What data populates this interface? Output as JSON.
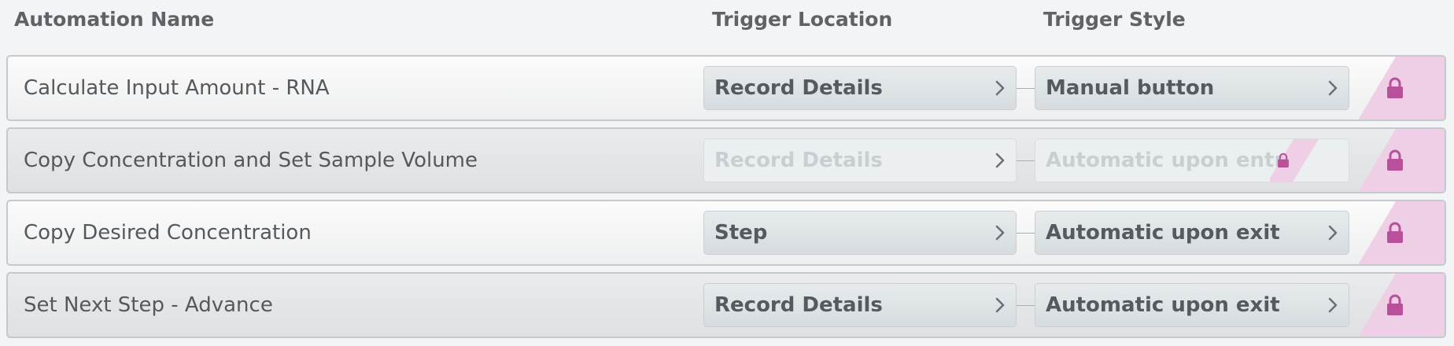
{
  "header": {
    "col_name": "Automation Name",
    "col_location": "Trigger Location",
    "col_style": "Trigger Style"
  },
  "rows": [
    {
      "name": "Calculate Input Amount - RNA",
      "location": "Record Details",
      "style": "Manual button",
      "style_enabled": true,
      "locked": true
    },
    {
      "name": "Copy Concentration and Set Sample Volume",
      "location": "Record Details",
      "style": "Automatic upon entry",
      "style_enabled": false,
      "locked": true
    },
    {
      "name": "Copy Desired Concentration",
      "location": "Step",
      "style": "Automatic upon exit",
      "style_enabled": true,
      "locked": true
    },
    {
      "name": "Set Next Step - Advance",
      "location": "Record Details",
      "style": "Automatic upon exit",
      "style_enabled": true,
      "locked": true
    }
  ],
  "colors": {
    "lock": "#b8509a",
    "lock_band": "#efcfe6",
    "header_text": "#5f6266"
  },
  "icons": {
    "chevron": "chevron-right-icon",
    "lock": "lock-icon"
  }
}
